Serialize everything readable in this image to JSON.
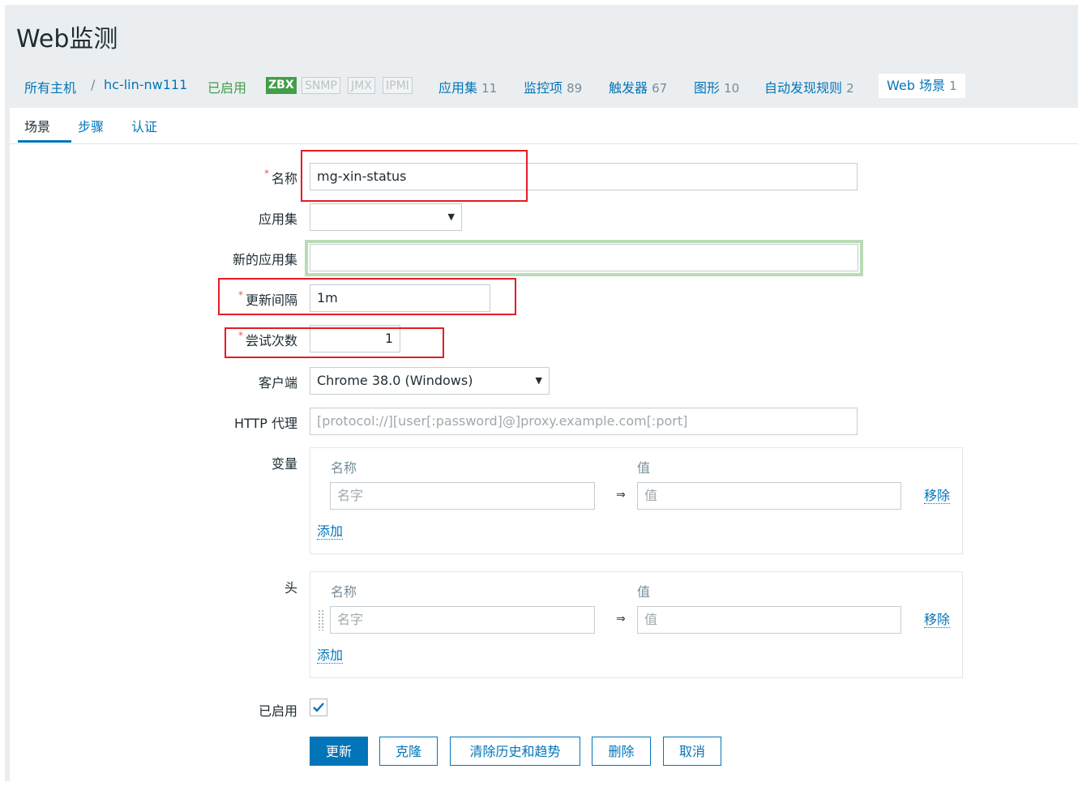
{
  "page": {
    "title": "Web监测"
  },
  "hostbar": {
    "all_hosts": "所有主机",
    "separator": "/",
    "host": "hc-lin-nw111",
    "status": "已启用",
    "availability": [
      "ZBX",
      "SNMP",
      "JMX",
      "IPMI"
    ],
    "links": [
      {
        "label": "应用集",
        "count": "11"
      },
      {
        "label": "监控项",
        "count": "89"
      },
      {
        "label": "触发器",
        "count": "67"
      },
      {
        "label": "图形",
        "count": "10"
      },
      {
        "label": "自动发现规则",
        "count": "2"
      }
    ],
    "web": {
      "label": "Web 场景",
      "count": "1"
    }
  },
  "tabs": [
    "场景",
    "步骤",
    "认证"
  ],
  "form": {
    "name": {
      "label": "名称",
      "value": "mg-xin-status"
    },
    "application": {
      "label": "应用集",
      "value": ""
    },
    "new_application": {
      "label": "新的应用集",
      "value": ""
    },
    "update_interval": {
      "label": "更新间隔",
      "value": "1m"
    },
    "attempts": {
      "label": "尝试次数",
      "value": "1"
    },
    "agent": {
      "label": "客户端",
      "value": "Chrome 38.0 (Windows)"
    },
    "http_proxy": {
      "label": "HTTP 代理",
      "placeholder": "[protocol://][user[:password]@]proxy.example.com[:port]"
    },
    "variables": {
      "label": "变量",
      "col_name": "名称",
      "col_value": "值",
      "name_placeholder": "名字",
      "value_placeholder": "值",
      "arrow": "⇒",
      "remove": "移除",
      "add": "添加"
    },
    "headers": {
      "label": "头",
      "col_name": "名称",
      "col_value": "值",
      "name_placeholder": "名字",
      "value_placeholder": "值",
      "arrow": "⇒",
      "remove": "移除",
      "add": "添加"
    },
    "enabled": {
      "label": "已启用",
      "checked": true
    }
  },
  "buttons": {
    "update": "更新",
    "clone": "克隆",
    "clear_history": "清除历史和趋势",
    "delete": "删除",
    "cancel": "取消"
  },
  "colors": {
    "link_blue": "#0275b8",
    "enabled_green": "#429e47",
    "highlight_red": "#e41b26",
    "highlight_green": "#b9dcb4"
  }
}
